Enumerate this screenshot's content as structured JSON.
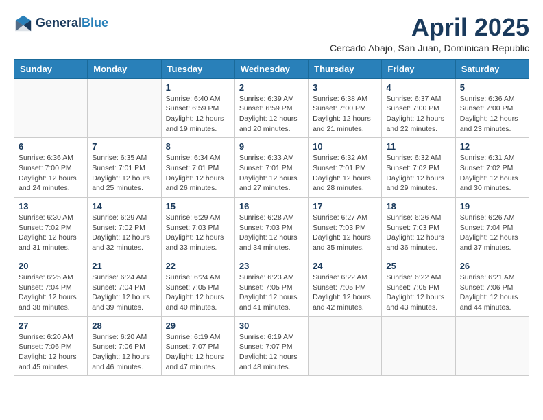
{
  "header": {
    "logo_general": "General",
    "logo_blue": "Blue",
    "month_title": "April 2025",
    "subtitle": "Cercado Abajo, San Juan, Dominican Republic"
  },
  "weekdays": [
    "Sunday",
    "Monday",
    "Tuesday",
    "Wednesday",
    "Thursday",
    "Friday",
    "Saturday"
  ],
  "weeks": [
    [
      {
        "day": "",
        "info": ""
      },
      {
        "day": "",
        "info": ""
      },
      {
        "day": "1",
        "info": "Sunrise: 6:40 AM\nSunset: 6:59 PM\nDaylight: 12 hours and 19 minutes."
      },
      {
        "day": "2",
        "info": "Sunrise: 6:39 AM\nSunset: 6:59 PM\nDaylight: 12 hours and 20 minutes."
      },
      {
        "day": "3",
        "info": "Sunrise: 6:38 AM\nSunset: 7:00 PM\nDaylight: 12 hours and 21 minutes."
      },
      {
        "day": "4",
        "info": "Sunrise: 6:37 AM\nSunset: 7:00 PM\nDaylight: 12 hours and 22 minutes."
      },
      {
        "day": "5",
        "info": "Sunrise: 6:36 AM\nSunset: 7:00 PM\nDaylight: 12 hours and 23 minutes."
      }
    ],
    [
      {
        "day": "6",
        "info": "Sunrise: 6:36 AM\nSunset: 7:00 PM\nDaylight: 12 hours and 24 minutes."
      },
      {
        "day": "7",
        "info": "Sunrise: 6:35 AM\nSunset: 7:01 PM\nDaylight: 12 hours and 25 minutes."
      },
      {
        "day": "8",
        "info": "Sunrise: 6:34 AM\nSunset: 7:01 PM\nDaylight: 12 hours and 26 minutes."
      },
      {
        "day": "9",
        "info": "Sunrise: 6:33 AM\nSunset: 7:01 PM\nDaylight: 12 hours and 27 minutes."
      },
      {
        "day": "10",
        "info": "Sunrise: 6:32 AM\nSunset: 7:01 PM\nDaylight: 12 hours and 28 minutes."
      },
      {
        "day": "11",
        "info": "Sunrise: 6:32 AM\nSunset: 7:02 PM\nDaylight: 12 hours and 29 minutes."
      },
      {
        "day": "12",
        "info": "Sunrise: 6:31 AM\nSunset: 7:02 PM\nDaylight: 12 hours and 30 minutes."
      }
    ],
    [
      {
        "day": "13",
        "info": "Sunrise: 6:30 AM\nSunset: 7:02 PM\nDaylight: 12 hours and 31 minutes."
      },
      {
        "day": "14",
        "info": "Sunrise: 6:29 AM\nSunset: 7:02 PM\nDaylight: 12 hours and 32 minutes."
      },
      {
        "day": "15",
        "info": "Sunrise: 6:29 AM\nSunset: 7:03 PM\nDaylight: 12 hours and 33 minutes."
      },
      {
        "day": "16",
        "info": "Sunrise: 6:28 AM\nSunset: 7:03 PM\nDaylight: 12 hours and 34 minutes."
      },
      {
        "day": "17",
        "info": "Sunrise: 6:27 AM\nSunset: 7:03 PM\nDaylight: 12 hours and 35 minutes."
      },
      {
        "day": "18",
        "info": "Sunrise: 6:26 AM\nSunset: 7:03 PM\nDaylight: 12 hours and 36 minutes."
      },
      {
        "day": "19",
        "info": "Sunrise: 6:26 AM\nSunset: 7:04 PM\nDaylight: 12 hours and 37 minutes."
      }
    ],
    [
      {
        "day": "20",
        "info": "Sunrise: 6:25 AM\nSunset: 7:04 PM\nDaylight: 12 hours and 38 minutes."
      },
      {
        "day": "21",
        "info": "Sunrise: 6:24 AM\nSunset: 7:04 PM\nDaylight: 12 hours and 39 minutes."
      },
      {
        "day": "22",
        "info": "Sunrise: 6:24 AM\nSunset: 7:05 PM\nDaylight: 12 hours and 40 minutes."
      },
      {
        "day": "23",
        "info": "Sunrise: 6:23 AM\nSunset: 7:05 PM\nDaylight: 12 hours and 41 minutes."
      },
      {
        "day": "24",
        "info": "Sunrise: 6:22 AM\nSunset: 7:05 PM\nDaylight: 12 hours and 42 minutes."
      },
      {
        "day": "25",
        "info": "Sunrise: 6:22 AM\nSunset: 7:05 PM\nDaylight: 12 hours and 43 minutes."
      },
      {
        "day": "26",
        "info": "Sunrise: 6:21 AM\nSunset: 7:06 PM\nDaylight: 12 hours and 44 minutes."
      }
    ],
    [
      {
        "day": "27",
        "info": "Sunrise: 6:20 AM\nSunset: 7:06 PM\nDaylight: 12 hours and 45 minutes."
      },
      {
        "day": "28",
        "info": "Sunrise: 6:20 AM\nSunset: 7:06 PM\nDaylight: 12 hours and 46 minutes."
      },
      {
        "day": "29",
        "info": "Sunrise: 6:19 AM\nSunset: 7:07 PM\nDaylight: 12 hours and 47 minutes."
      },
      {
        "day": "30",
        "info": "Sunrise: 6:19 AM\nSunset: 7:07 PM\nDaylight: 12 hours and 48 minutes."
      },
      {
        "day": "",
        "info": ""
      },
      {
        "day": "",
        "info": ""
      },
      {
        "day": "",
        "info": ""
      }
    ]
  ]
}
